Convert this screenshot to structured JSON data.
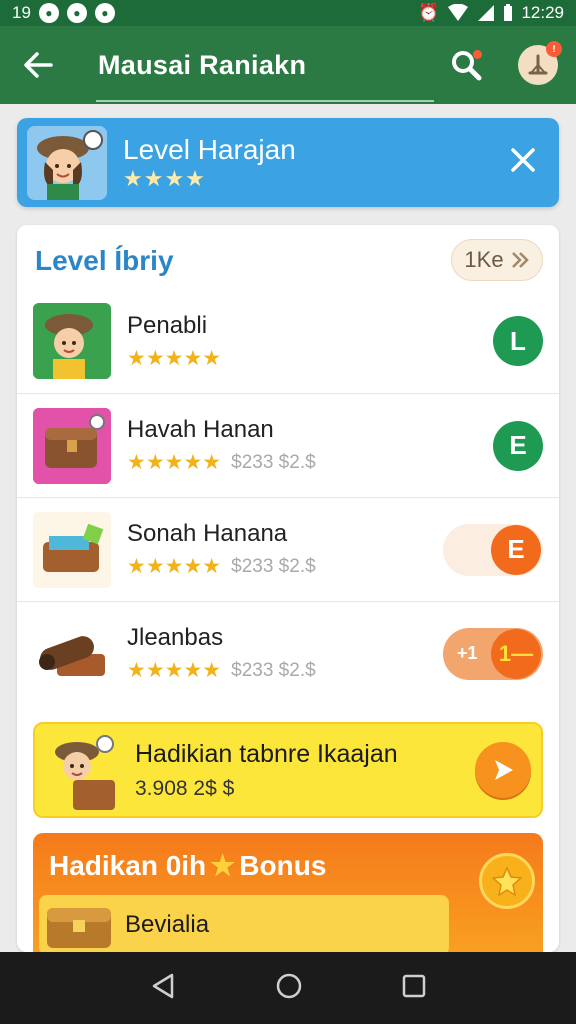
{
  "status_bar": {
    "left_text": "19",
    "time": "12:29"
  },
  "app_bar": {
    "title": "Mausai Raniakn"
  },
  "banner": {
    "title": "Level Harajan",
    "stars": "★★★★"
  },
  "section": {
    "title": "Level Íbriy",
    "chip_label": "1Ke"
  },
  "items": [
    {
      "title": "Penabli",
      "stars": "★★★★★",
      "price": "",
      "badge": "L",
      "badge_color": "#1f9a53"
    },
    {
      "title": "Havah Hanan",
      "stars": "★★★★★",
      "price": "$233 $2.$",
      "badge": "E",
      "badge_color": "#1f9a53"
    },
    {
      "title": "Sonah Hanana",
      "stars": "★★★★★",
      "price": "$233 $2.$",
      "badge": "E",
      "badge_color": "#f26b1d"
    },
    {
      "title": "Jleanbas",
      "stars": "★★★★★",
      "price": "$233 $2.$",
      "badge": "1—",
      "badge_prefix": "+1",
      "badge_color": "#f26b1d"
    }
  ],
  "promo": {
    "title": "Hadikian tabnre Ikaajan",
    "subtitle": "3.908 2$ $"
  },
  "bonus": {
    "title_left": "Hadikan 0ih",
    "title_right": "Bonus",
    "inner_label": "Bevialia"
  },
  "colors": {
    "app_bar": "#2b7a44",
    "status_bar": "#1e6b3a",
    "banner": "#3ba3e3",
    "accent_blue": "#2a86c8",
    "star": "#f1b31c",
    "green_badge": "#1f9a53",
    "orange_badge": "#f26b1d"
  },
  "icons": {
    "back": "arrow-left-icon",
    "search": "search-icon",
    "close": "close-icon",
    "nav_back": "triangle-back-icon",
    "nav_home": "circle-home-icon",
    "nav_recent": "square-recent-icon"
  }
}
